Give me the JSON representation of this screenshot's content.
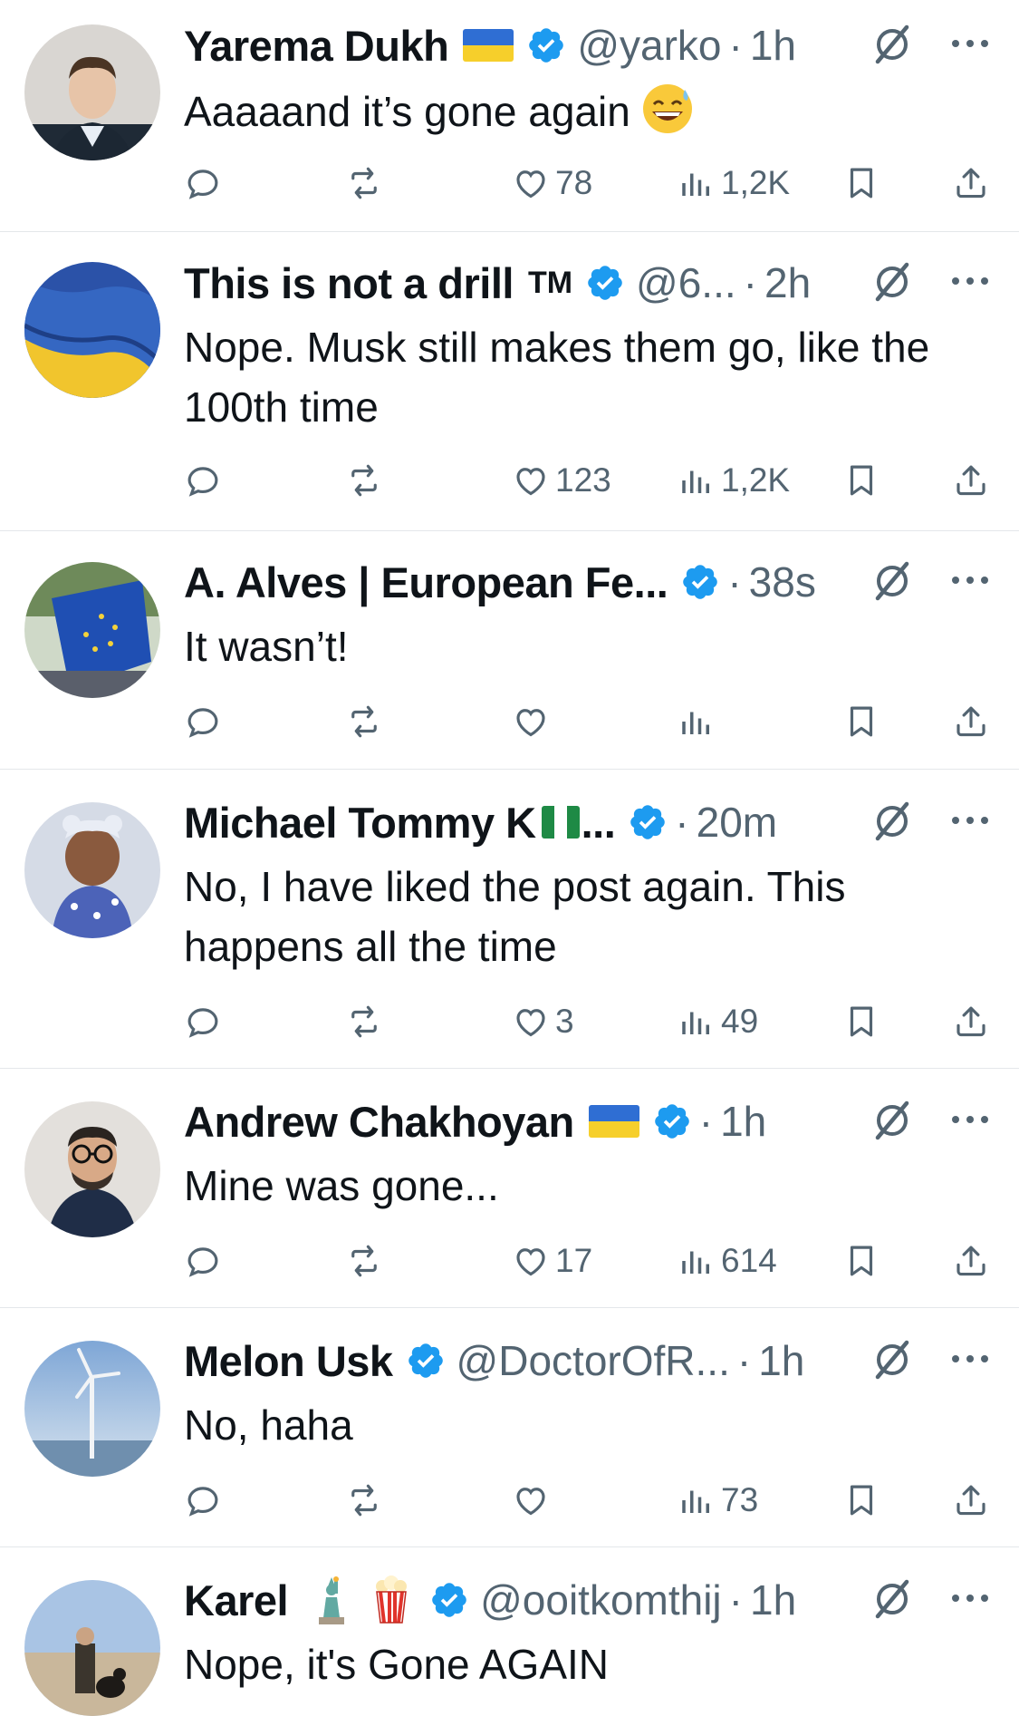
{
  "tweets": [
    {
      "name": "Yarema Dukh",
      "handle": "@yarko",
      "time": "1h",
      "text": "Aaaaand it’s gone again",
      "likes": "78",
      "views": "1,2K",
      "flag": "ukraine",
      "avatar": "man-portrait"
    },
    {
      "name": "This is not a drill",
      "tm": "TM",
      "handle": "@6...",
      "time": "2h",
      "text": "Nope. Musk still makes them go, like the 100th time",
      "likes": "123",
      "views": "1,2K",
      "avatar": "ukraine-flag-waving"
    },
    {
      "name": "A. Alves | European Fe...",
      "handle": "",
      "time": "38s",
      "text": "It wasn’t!",
      "likes": "",
      "views": "",
      "avatar": "eu-flag-crowd"
    },
    {
      "name": "Michael Tommy K",
      "name_suffix": "...",
      "handle": "",
      "time": "20m",
      "text": "No, I have liked the post again. This happens all the time",
      "likes": "3",
      "views": "49",
      "flag": "nigeria",
      "avatar": "baby-portrait"
    },
    {
      "name": "Andrew Chakhoyan",
      "handle": "",
      "time": "1h",
      "text": "Mine was gone...",
      "likes": "17",
      "views": "614",
      "flag": "ukraine",
      "avatar": "man-glasses-portrait"
    },
    {
      "name": "Melon Usk",
      "handle": "@DoctorOfR...",
      "time": "1h",
      "text": "No, haha",
      "likes": "",
      "views": "73",
      "avatar": "wind-turbine"
    },
    {
      "name": "Karel",
      "handle": "@ooitkomthij",
      "time": "1h",
      "text": "Nope, it's Gone AGAIN",
      "likes": "",
      "views": "",
      "avatar": "beach-person-dog",
      "emojis": [
        "statue-of-liberty-icon",
        "popcorn-icon"
      ]
    }
  ],
  "colors": {
    "verified": "#1d9bf0",
    "text": "#0f1419",
    "muted": "#536471",
    "divider": "#e4e7ea"
  },
  "separator": "·"
}
